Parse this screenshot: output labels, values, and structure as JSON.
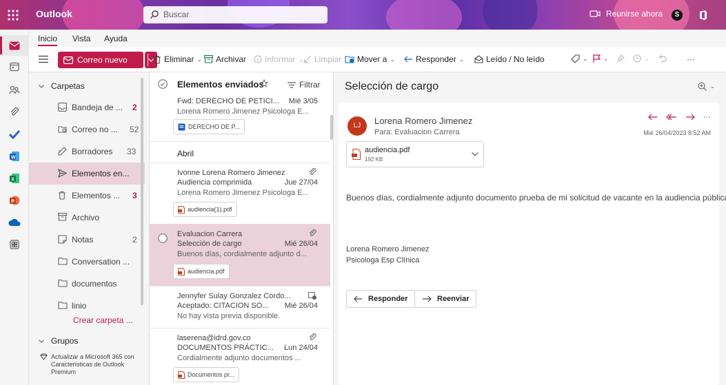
{
  "topbar": {
    "app_name": "Outlook",
    "search_placeholder": "Buscar",
    "meet_now": "Reunirse ahora",
    "skype_letter": "S"
  },
  "tabs": [
    "Inicio",
    "Vista",
    "Ayuda"
  ],
  "ribbon": {
    "new_mail": "Correo nuevo",
    "delete": "Eliminar",
    "archive": "Archivar",
    "report": "Informar",
    "sweep": "Limpiar",
    "move_to": "Mover a",
    "reply": "Responder",
    "read_unread": "Leído / No leído",
    "more": "···"
  },
  "folders": {
    "header": "Carpetas",
    "items": [
      {
        "label": "Bandeja de ...",
        "count": "2"
      },
      {
        "label": "Correo no ...",
        "count": "52"
      },
      {
        "label": "Borradores",
        "count": "33"
      },
      {
        "label": "Elementos en...",
        "count": ""
      },
      {
        "label": "Elementos ...",
        "count": "3"
      },
      {
        "label": "Archivo",
        "count": ""
      },
      {
        "label": "Notas",
        "count": "2"
      },
      {
        "label": "Conversation ...",
        "count": ""
      },
      {
        "label": "documentos",
        "count": ""
      },
      {
        "label": "linio",
        "count": ""
      }
    ],
    "create_folder": "Crear carpeta ...",
    "groups_header": "Grupos",
    "upgrade_text": "Actualizar a Microsoft 365 con Características de Outlook Premium"
  },
  "message_list": {
    "title": "Elementos enviados",
    "filter": "Filtrar",
    "month_label": "Abril",
    "messages": [
      {
        "from": "",
        "subject": "Fwd: DERECHO DE PETICI...",
        "date": "Mié 3/05",
        "preview": "Lorena Romero Jimenez Psicologa E...",
        "attachment": "DERECHO DE P..."
      },
      {
        "from": "Ivonne Lorena Romero Jimenez",
        "subject": "Audiencia comprimida",
        "date": "Jue 27/04",
        "preview": "Lorena Romero Jimenez Psicologa E...",
        "attachment": "audiencia(1).pdf"
      },
      {
        "from": "Evaluacion Carrera",
        "subject": "Selección de cargo",
        "date": "Mié 26/04",
        "preview": "Buenos días, cordialmente adjunto d...",
        "attachment": "audiencia.pdf"
      },
      {
        "from": "Jennyfer Sulay Gonzalez Cordo...",
        "subject": "Aceptado: CITACION SO...",
        "date": "Mié 26/04",
        "preview": "No hay vista previa disponible.",
        "attachment": ""
      },
      {
        "from": "laserena@idrd.gov.co",
        "subject": "DOCUMENTOS PRÁCTIC...",
        "date": "Lun 24/04",
        "preview": "Cordialmente adjunto documentos ...",
        "attachment": "Documentos pr..."
      }
    ]
  },
  "reading": {
    "title": "Selección de cargo",
    "avatar_initials": "LJ",
    "sender": "Lorena Romero Jimenez",
    "to": "Para:  Evaluacion Carrera",
    "date": "Mié 26/04/2023 8:52 AM",
    "attachment_name": "audiencia.pdf",
    "attachment_size": "192 KB",
    "body": "Buenos días, cordialmente adjunto documento prueba de mi solicitud de vacante en la audiencia pública.",
    "signature_name": "Lorena Romero Jimenez",
    "signature_title": "Psicologa Esp Clínica",
    "reply_button": "Responder",
    "forward_button": "Reenviar"
  },
  "colors": {
    "accent": "#c01b4b",
    "selected_bg": "#ebd2da"
  }
}
